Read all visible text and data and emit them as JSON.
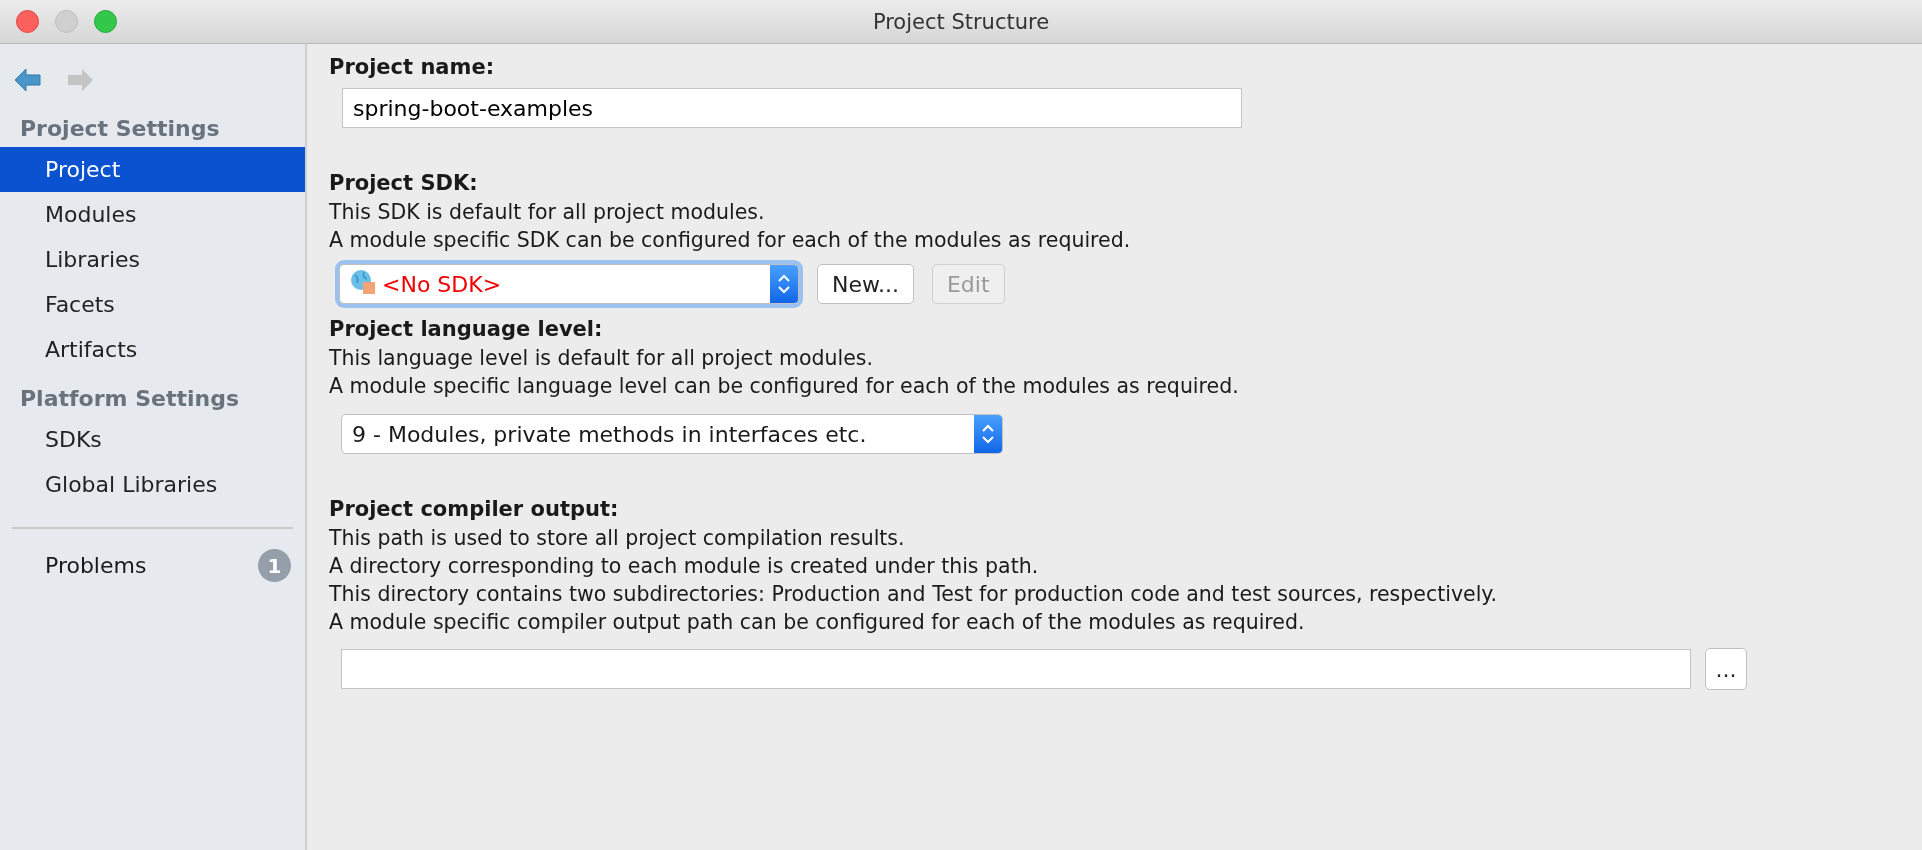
{
  "window": {
    "title": "Project Structure"
  },
  "sidebar": {
    "sections": [
      {
        "title": "Project Settings",
        "items": [
          {
            "label": "Project",
            "selected": true
          },
          {
            "label": "Modules",
            "selected": false
          },
          {
            "label": "Libraries",
            "selected": false
          },
          {
            "label": "Facets",
            "selected": false
          },
          {
            "label": "Artifacts",
            "selected": false
          }
        ]
      },
      {
        "title": "Platform Settings",
        "items": [
          {
            "label": "SDKs",
            "selected": false
          },
          {
            "label": "Global Libraries",
            "selected": false
          }
        ]
      }
    ],
    "problems": {
      "label": "Problems",
      "count": "1"
    }
  },
  "project_name": {
    "label": "Project name:",
    "value": "spring-boot-examples"
  },
  "project_sdk": {
    "label": "Project SDK:",
    "description": [
      "This SDK is default for all project modules.",
      "A module specific SDK can be configured for each of the modules as required."
    ],
    "value": "<No SDK>",
    "buttons": [
      {
        "label": "New...",
        "disabled": false
      },
      {
        "label": "Edit",
        "disabled": true
      }
    ]
  },
  "language_level": {
    "label": "Project language level:",
    "description": [
      "This language level is default for all project modules.",
      "A module specific language level can be configured for each of the modules as required."
    ],
    "value": "9 - Modules, private methods in interfaces etc."
  },
  "compiler_output": {
    "label": "Project compiler output:",
    "description": [
      "This path is used to store all project compilation results.",
      "A directory corresponding to each module is created under this path.",
      "This directory contains two subdirectories: Production and Test for production code and test sources, respectively.",
      "A module specific compiler output path can be configured for each of the modules as required."
    ],
    "browse": "..."
  }
}
